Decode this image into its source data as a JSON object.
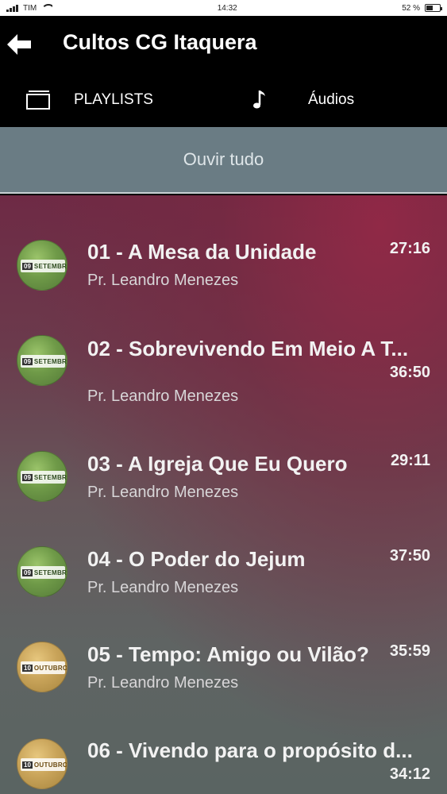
{
  "status_bar": {
    "carrier": "TIM",
    "time": "14:32",
    "battery": "52 %",
    "battery_level": 0.52
  },
  "header": {
    "title": "Cultos CG Itaquera",
    "back_icon": "arrow-left-icon"
  },
  "tabs": [
    {
      "label": "PLAYLISTS",
      "icon": "playlist-icon"
    },
    {
      "label": "Áudios",
      "icon": "music-note-icon"
    }
  ],
  "play_all": {
    "label": "Ouvir tudo"
  },
  "tracks": [
    {
      "title": "01 - A Mesa da Unidade",
      "author": "Pr. Leandro Menezes",
      "duration": "27:16",
      "thumb_day": "09",
      "thumb_month": "SETEMBRO",
      "thumb_color": "#6f9a48"
    },
    {
      "title": "02 - Sobrevivendo Em Meio A T...",
      "author": "Pr. Leandro Menezes",
      "duration": "36:50",
      "thumb_day": "09",
      "thumb_month": "SETEMBRO",
      "thumb_color": "#6f9a48"
    },
    {
      "title": "03 - A Igreja Que Eu Quero",
      "author": "Pr. Leandro Menezes",
      "duration": "29:11",
      "thumb_day": "09",
      "thumb_month": "SETEMBRO",
      "thumb_color": "#6f9a48"
    },
    {
      "title": "04 - O Poder do Jejum",
      "author": "Pr. Leandro Menezes",
      "duration": "37:50",
      "thumb_day": "09",
      "thumb_month": "SETEMBRO",
      "thumb_color": "#6f9a48"
    },
    {
      "title": "05 - Tempo: Amigo ou Vilão?",
      "author": "Pr. Leandro Menezes",
      "duration": "35:59",
      "thumb_day": "10",
      "thumb_month": "OUTUBRO",
      "thumb_color": "#c9a45a"
    },
    {
      "title": "06 - Vivendo para o propósito d...",
      "author": "",
      "duration": "34:12",
      "thumb_day": "10",
      "thumb_month": "OUTUBRO",
      "thumb_color": "#c9a45a"
    }
  ]
}
